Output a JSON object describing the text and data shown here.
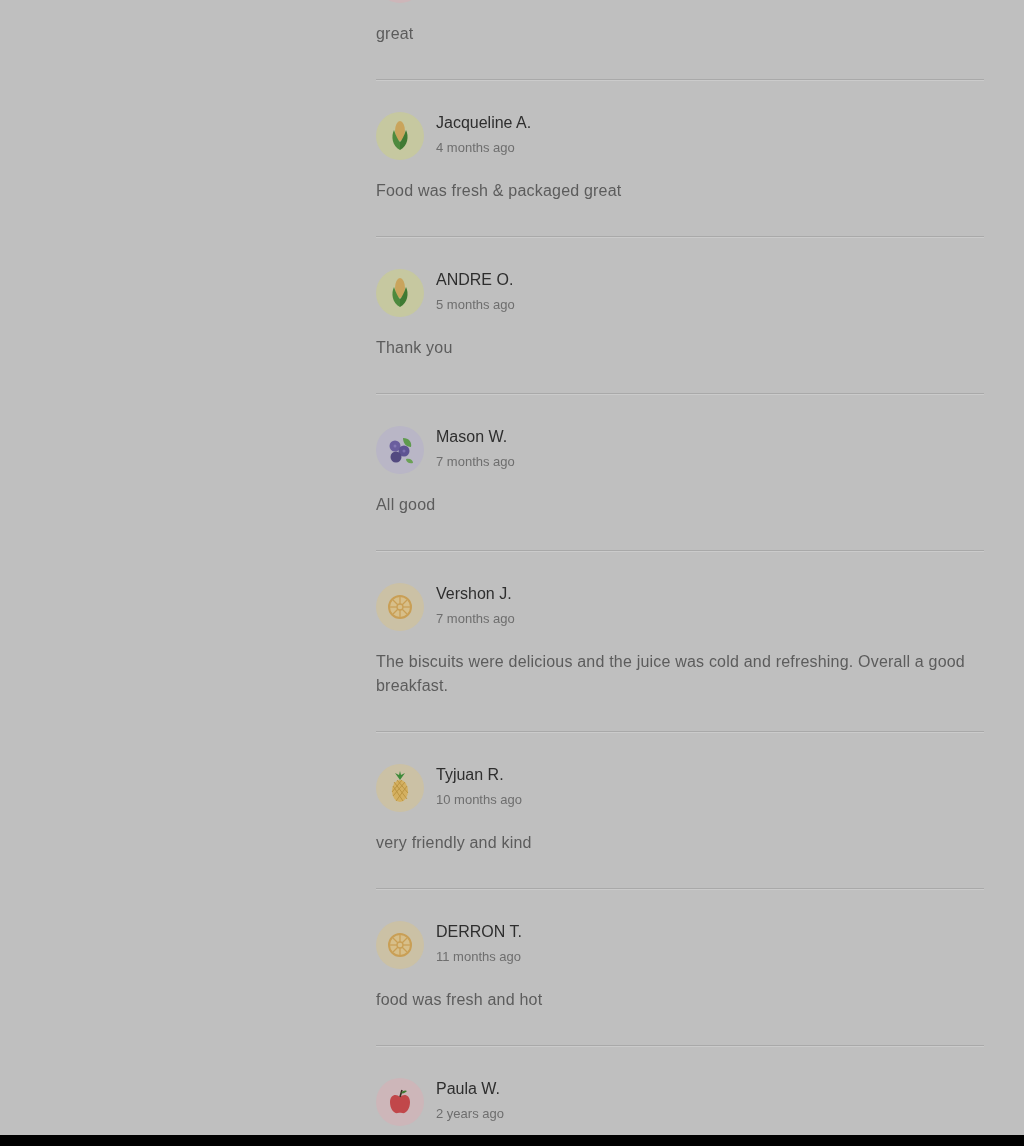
{
  "reviews": [
    {
      "avatar": {
        "kind": "apple"
      },
      "comment": "great"
    },
    {
      "avatar": {
        "kind": "corn"
      },
      "name": "Jacqueline A.",
      "date": "4 months ago",
      "comment": "Food was fresh & packaged great"
    },
    {
      "avatar": {
        "kind": "corn"
      },
      "name": "ANDRE O.",
      "date": "5 months ago",
      "comment": "Thank you"
    },
    {
      "avatar": {
        "kind": "blueberries"
      },
      "name": "Mason W.",
      "date": "7 months ago",
      "comment": "All good"
    },
    {
      "avatar": {
        "kind": "citrus"
      },
      "name": "Vershon J.",
      "date": "7 months ago",
      "comment": "The biscuits were delicious and the juice was cold and refreshing. Overall a good breakfast."
    },
    {
      "avatar": {
        "kind": "pineapple"
      },
      "name": "Tyjuan R.",
      "date": "10 months ago",
      "comment": "very friendly and kind"
    },
    {
      "avatar": {
        "kind": "citrus"
      },
      "name": "DERRON T.",
      "date": "11 months ago",
      "comment": "food was fresh and hot"
    },
    {
      "avatar": {
        "kind": "apple"
      },
      "name": "Paula W.",
      "date": "2 years ago"
    }
  ]
}
